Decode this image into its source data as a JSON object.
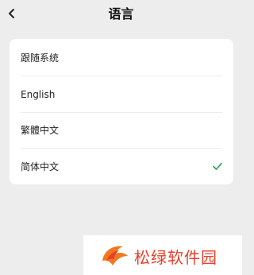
{
  "header": {
    "title": "语言"
  },
  "languages": [
    {
      "label": "跟随系统",
      "selected": false
    },
    {
      "label": "English",
      "selected": false
    },
    {
      "label": "繁體中文",
      "selected": false
    },
    {
      "label": "简体中文",
      "selected": true
    }
  ],
  "icons": {
    "back": "chevron-left-icon",
    "check": "check-icon"
  },
  "colors": {
    "check": "#2f9e59",
    "watermark": "#e8402a"
  },
  "watermark": {
    "text": "松绿软件园"
  }
}
